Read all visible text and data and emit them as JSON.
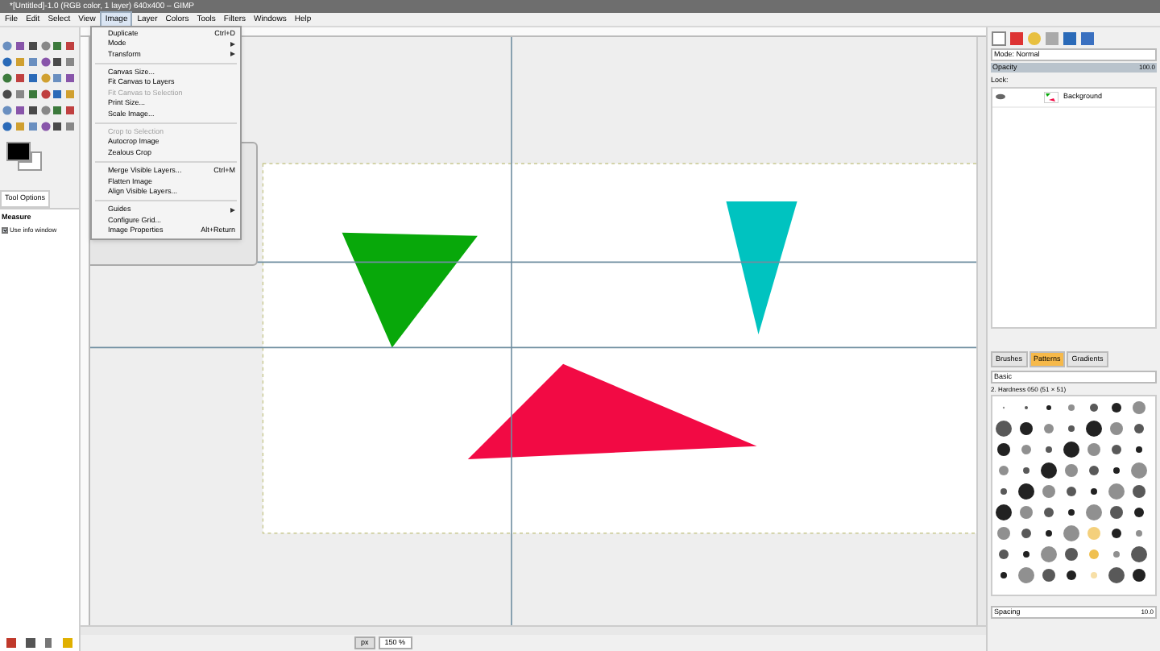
{
  "window": {
    "title": "*[Untitled]-1.0 (RGB color, 1 layer) 640x400 – GIMP"
  },
  "menubar": [
    {
      "label": "File",
      "selected": false
    },
    {
      "label": "Edit",
      "selected": false
    },
    {
      "label": "Select",
      "selected": false
    },
    {
      "label": "View",
      "selected": false
    },
    {
      "label": "Image",
      "selected": true
    },
    {
      "label": "Layer",
      "selected": false
    },
    {
      "label": "Colors",
      "selected": false
    },
    {
      "label": "Tools",
      "selected": false
    },
    {
      "label": "Filters",
      "selected": false
    },
    {
      "label": "Windows",
      "selected": false
    },
    {
      "label": "Help",
      "selected": false
    }
  ],
  "image_menu": [
    {
      "kind": "item",
      "label": "Duplicate",
      "shortcut": "Ctrl+D",
      "disabled": false,
      "submenu": false
    },
    {
      "kind": "item",
      "label": "Mode",
      "disabled": false,
      "submenu": true
    },
    {
      "kind": "item",
      "label": "Transform",
      "disabled": false,
      "submenu": true
    },
    {
      "kind": "separator"
    },
    {
      "kind": "item",
      "label": "Canvas Size...",
      "disabled": false,
      "submenu": false
    },
    {
      "kind": "item",
      "label": "Fit Canvas to Layers",
      "disabled": false,
      "submenu": false
    },
    {
      "kind": "item",
      "label": "Fit Canvas to Selection",
      "disabled": true,
      "submenu": false
    },
    {
      "kind": "item",
      "label": "Print Size...",
      "disabled": false,
      "submenu": false
    },
    {
      "kind": "item",
      "label": "Scale Image...",
      "disabled": false,
      "submenu": false
    },
    {
      "kind": "separator"
    },
    {
      "kind": "item",
      "label": "Crop to Selection",
      "disabled": true,
      "submenu": false
    },
    {
      "kind": "item",
      "label": "Autocrop Image",
      "disabled": false,
      "submenu": false
    },
    {
      "kind": "item",
      "label": "Zealous Crop",
      "disabled": false,
      "submenu": false
    },
    {
      "kind": "separator"
    },
    {
      "kind": "item",
      "label": "Merge Visible Layers...",
      "shortcut": "Ctrl+M",
      "disabled": false,
      "submenu": false
    },
    {
      "kind": "item",
      "label": "Flatten Image",
      "disabled": false,
      "submenu": false
    },
    {
      "kind": "item",
      "label": "Align Visible Layers...",
      "disabled": false,
      "submenu": false
    },
    {
      "kind": "separator"
    },
    {
      "kind": "item",
      "label": "Guides",
      "disabled": false,
      "submenu": true
    },
    {
      "kind": "item",
      "label": "Configure Grid...",
      "disabled": false,
      "submenu": false
    },
    {
      "kind": "item",
      "label": "Image Properties",
      "shortcut": "Alt+Return",
      "disabled": false,
      "submenu": false
    }
  ],
  "tool_options": {
    "tab": "Tool Options",
    "section": "Measure",
    "checkbox": {
      "label": "Use info window",
      "checked": true
    }
  },
  "layers": {
    "mode": "Mode: Normal",
    "opacity_label": "Opacity",
    "opacity_value": "100.0",
    "lock": "Lock:",
    "items": [
      {
        "name": "Background",
        "selected": false
      }
    ]
  },
  "brushes": {
    "tabs": [
      {
        "label": "Brushes",
        "selected": false
      },
      {
        "label": "Patterns",
        "selected": true
      },
      {
        "label": "Gradients",
        "selected": false
      }
    ],
    "filter": "Basic",
    "brush_name": "2. Hardness 050 (51 × 51)",
    "spacing_label": "Spacing",
    "spacing_value": "10.0"
  },
  "status": {
    "unit": "px",
    "zoom": "150 %"
  }
}
